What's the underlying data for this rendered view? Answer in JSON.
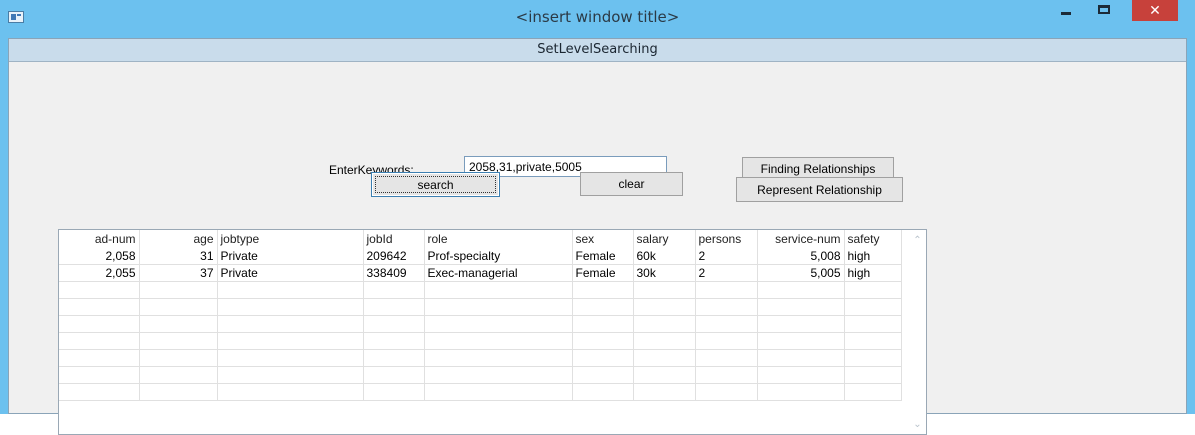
{
  "window": {
    "title": "<insert window title>",
    "minimize_glyph": "",
    "maximize_glyph": "",
    "close_glyph": "✕"
  },
  "form": {
    "header": "SetLevelSearching",
    "keywords_label": "EnterKeywords:",
    "keywords_value": "2058,31,private,5005",
    "search_label": "search",
    "clear_label": "clear",
    "finding_label": "Finding Relationships",
    "represent_label": "Represent Relationship"
  },
  "table": {
    "columns": [
      "ad-num",
      "age",
      "jobtype",
      "jobId",
      "role",
      "sex",
      "salary",
      "persons",
      "service-num",
      "safety"
    ],
    "rows": [
      [
        "2,058",
        "31",
        "Private",
        "209642",
        "Prof-specialty",
        "Female",
        "60k",
        "2",
        "5,008",
        "high"
      ],
      [
        "2,055",
        "37",
        "Private",
        "338409",
        "Exec-managerial",
        "Female",
        "30k",
        "2",
        "5,005",
        "high"
      ]
    ],
    "empty_rows": 7,
    "scroll_up": "⌃",
    "scroll_down": "⌄"
  }
}
